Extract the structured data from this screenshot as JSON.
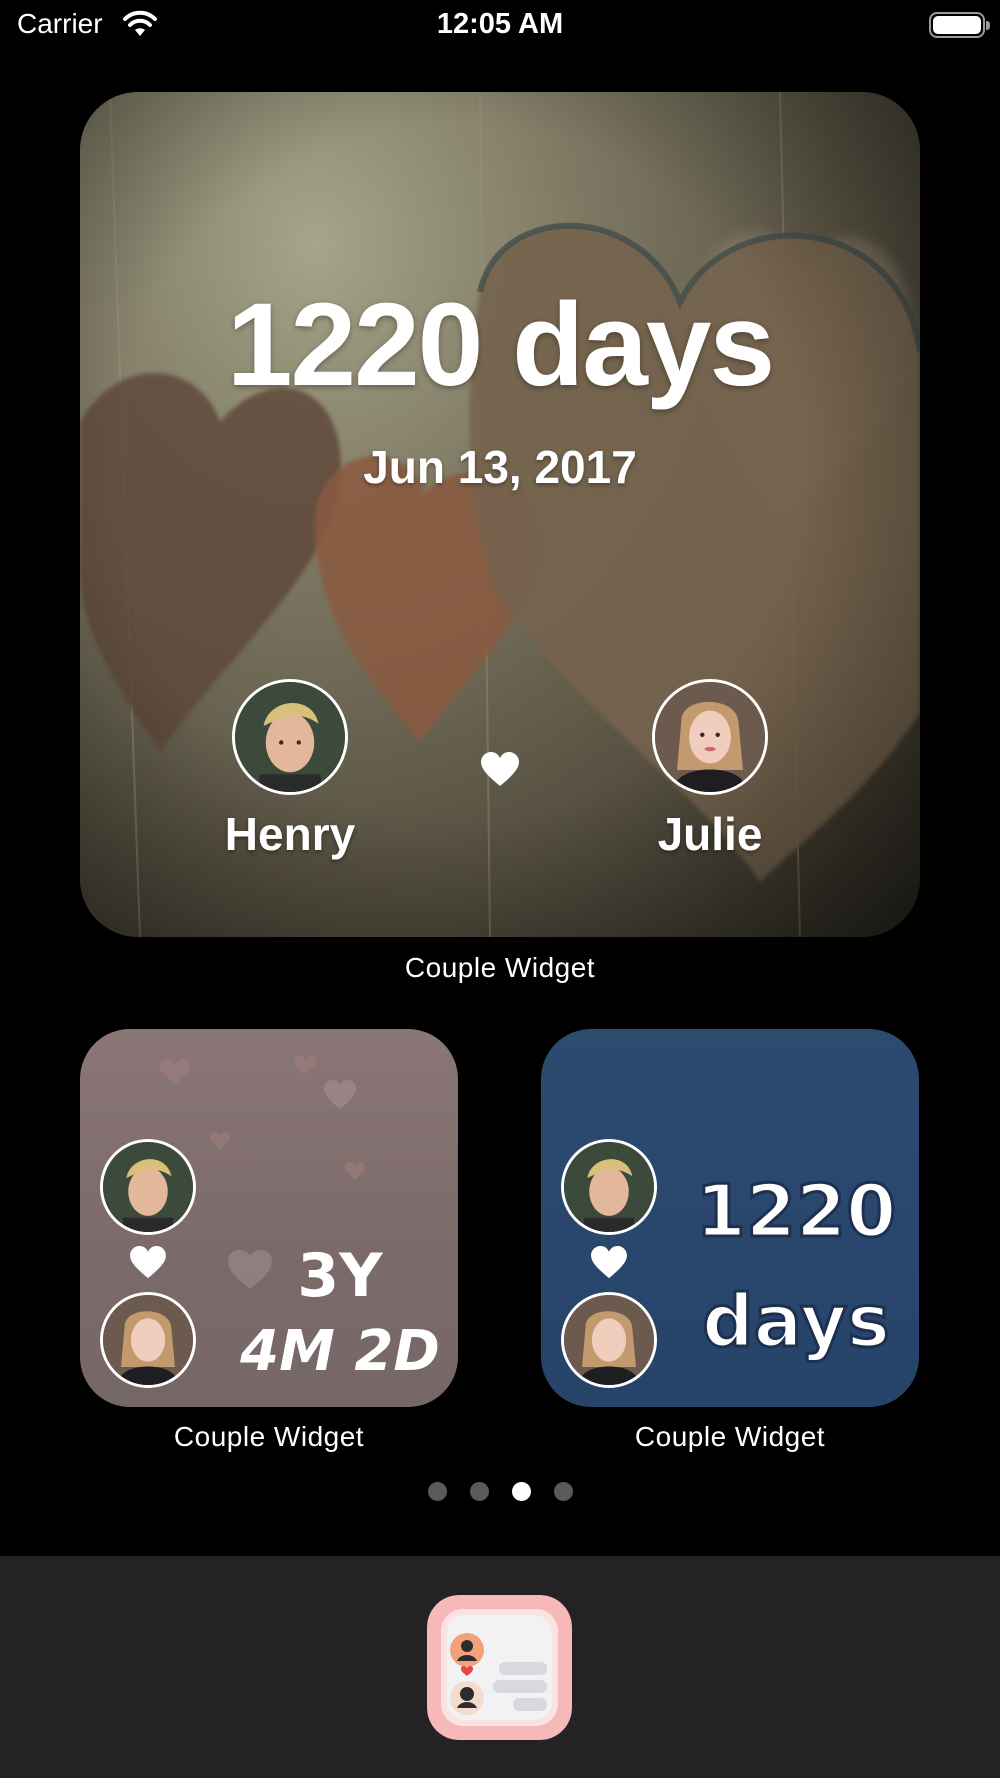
{
  "status_bar": {
    "carrier": "Carrier",
    "time": "12:05 AM"
  },
  "large_widget": {
    "days": "1220 days",
    "date": "Jun 13, 2017",
    "person_left": "Henry",
    "person_right": "Julie",
    "caption": "Couple Widget"
  },
  "small_widget_left": {
    "line1": "3Y",
    "line2": "4M 2D",
    "caption": "Couple Widget"
  },
  "small_widget_right": {
    "line1": "1220",
    "line2": "days",
    "caption": "Couple Widget"
  },
  "page_dots": {
    "count": 4,
    "active_index": 2
  },
  "colors": {
    "background": "#000000",
    "dock": "#232325",
    "pink_widget": "#7b6a69",
    "blue_widget": "#26436a",
    "app_icon": "#f7b8b8"
  }
}
